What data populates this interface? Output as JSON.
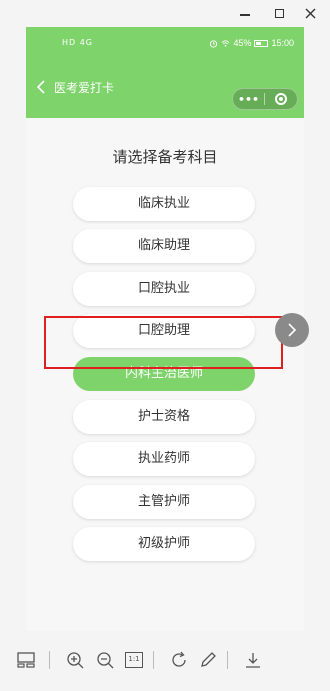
{
  "window": {
    "controls": [
      "minimize",
      "maximize",
      "close"
    ]
  },
  "status_bar": {
    "left_text": "HD 4G",
    "battery": "45%",
    "time": "15:00"
  },
  "nav": {
    "title": "医考爱打卡",
    "more_label": "•••"
  },
  "main": {
    "heading": "请选择备考科目",
    "options": [
      {
        "label": "临床执业",
        "selected": false
      },
      {
        "label": "临床助理",
        "selected": false
      },
      {
        "label": "口腔执业",
        "selected": false
      },
      {
        "label": "口腔助理",
        "selected": false
      },
      {
        "label": "内科主治医师",
        "selected": true
      },
      {
        "label": "护士资格",
        "selected": false
      },
      {
        "label": "执业药师",
        "selected": false
      },
      {
        "label": "主管护师",
        "selected": false
      },
      {
        "label": "初级护师",
        "selected": false
      }
    ]
  },
  "toolbar": {
    "items": [
      "thumbnail-icon",
      "zoom-in-icon",
      "zoom-out-icon",
      "actual-size-icon",
      "rotate-icon",
      "edit-icon",
      "download-icon"
    ],
    "actual_size_label": "1:1"
  },
  "colors": {
    "accent": "#7ed36b",
    "highlight": "#e02020"
  }
}
